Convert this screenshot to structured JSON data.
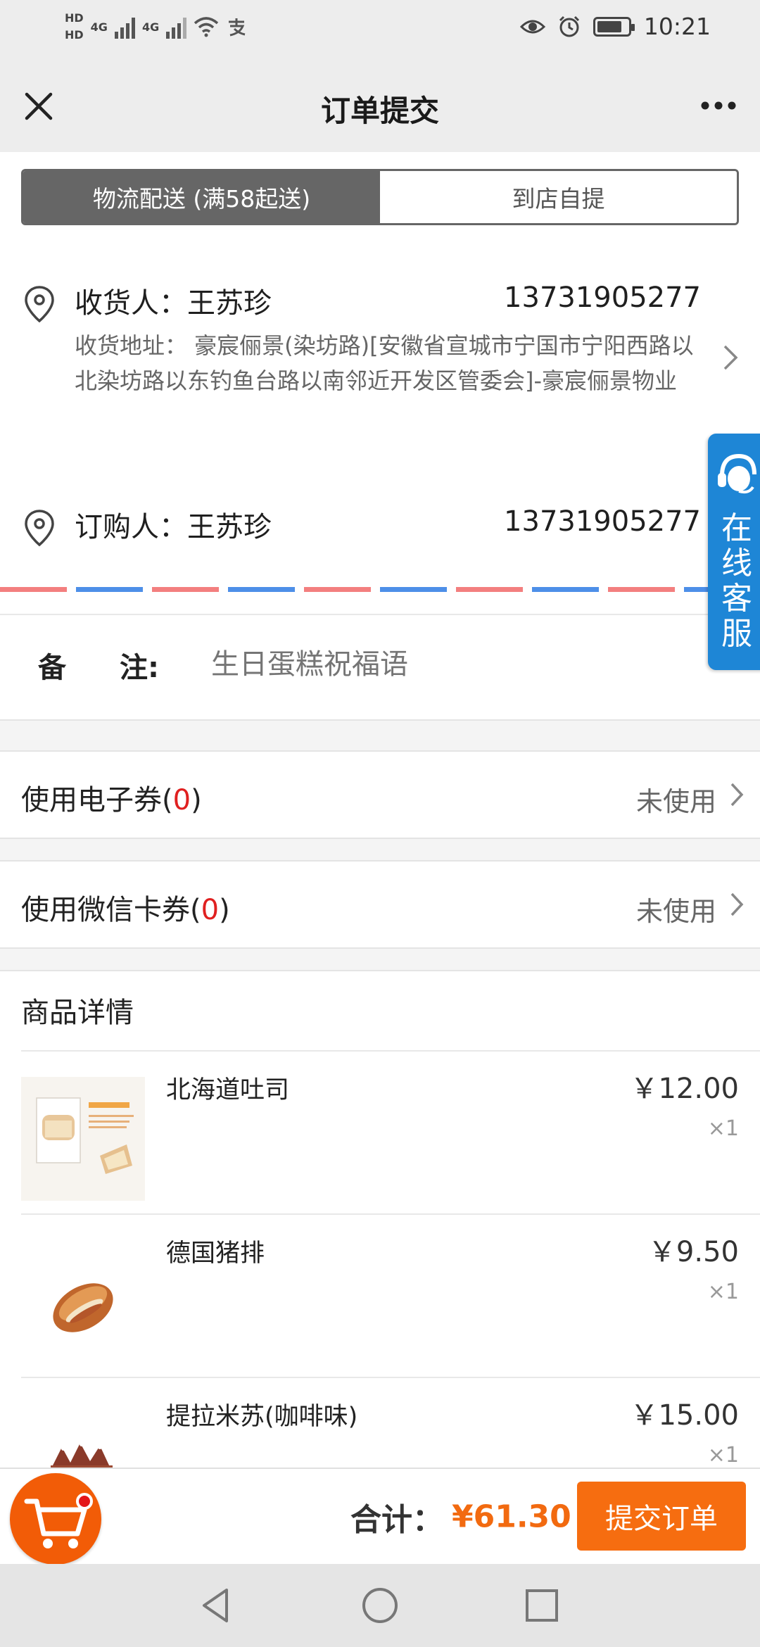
{
  "status_bar": {
    "time": "10:21",
    "network1": "4G",
    "network2": "4G",
    "hd1": "HD",
    "hd2": "HD"
  },
  "header": {
    "title": "订单提交"
  },
  "delivery_tabs": [
    {
      "label": "物流配送 (满58起送)",
      "active": true
    },
    {
      "label": "到店自提",
      "active": false
    }
  ],
  "receiver": {
    "name": "收货人：王苏珍",
    "phone": "13731905277",
    "address": "收货地址：  豪宸俪景(染坊路)[安徽省宣城市宁国市宁阳西路以北染坊路以东钓鱼台路以南邻近开发区管委会]-豪宸俪景物业"
  },
  "orderer": {
    "name": "订购人：王苏珍",
    "phone": "13731905277"
  },
  "remark": {
    "label_a": "备",
    "label_b": "注:",
    "placeholder": "生日蛋糕祝福语"
  },
  "coupons": [
    {
      "label": "使用电子券(",
      "count": "0",
      "close": ")",
      "value": "未使用"
    },
    {
      "label": "使用微信卡券(",
      "count": "0",
      "close": ")",
      "value": "未使用"
    }
  ],
  "products": {
    "title": "商品详情",
    "items": [
      {
        "name": "北海道吐司",
        "price": "￥12.00",
        "qty": "×1",
        "thumb_text": "北海道吐司"
      },
      {
        "name": "德国猪排",
        "price": "￥9.50",
        "qty": "×1"
      },
      {
        "name": "提拉米苏(咖啡味)",
        "price": "￥15.00",
        "qty": "×1"
      }
    ]
  },
  "footer": {
    "total_label": "合计：",
    "total_value": "¥61.30",
    "submit_label": "提交订单"
  },
  "floating_service": {
    "label": "在线客服"
  },
  "colors": {
    "accent": "#f66d10",
    "service_blue": "#1e86d6",
    "header_bg": "#ededed",
    "tab_active": "#666666",
    "coupon_count_red": "#e02020"
  },
  "icons": [
    "close-icon",
    "more-icon",
    "location-pin-icon",
    "chevron-right-icon",
    "cart-icon",
    "headset-icon",
    "back-nav-icon",
    "home-nav-icon",
    "recents-nav-icon"
  ]
}
